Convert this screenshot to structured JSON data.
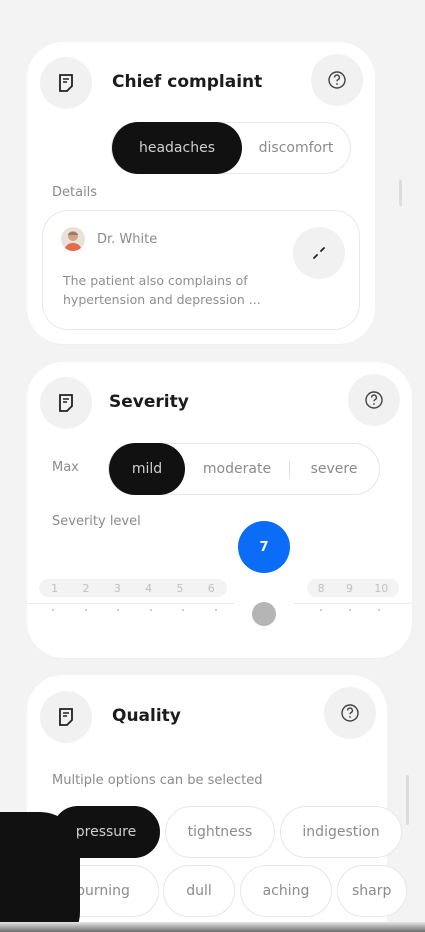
{
  "chief_complaint": {
    "title": "Chief complaint",
    "options": [
      "headaches",
      "discomfort"
    ],
    "selected": "headaches",
    "details_label": "Details",
    "doctor": "Dr. White",
    "details_text": "The patient also complains of hypertension and depression ..."
  },
  "severity": {
    "title": "Severity",
    "max_label": "Max",
    "options": [
      "mild",
      "moderate",
      "severe"
    ],
    "selected": "mild",
    "level_label": "Severity level",
    "level_value": "7",
    "scale_left": [
      "1",
      "2",
      "3",
      "4",
      "5",
      "6"
    ],
    "scale_right": [
      "8",
      "9",
      "10"
    ]
  },
  "quality": {
    "title": "Quality",
    "hint": "Multiple options can be selected",
    "options_row1": [
      "pressure",
      "tightness",
      "indigestion"
    ],
    "options_row2": [
      "burning",
      "dull",
      "aching",
      "sharp"
    ],
    "selected": [
      "pressure"
    ]
  },
  "colors": {
    "accent": "#0a6cf7",
    "active": "#111111"
  },
  "icons": [
    "note-icon",
    "help-icon",
    "expand-icon",
    "doctor-avatar"
  ]
}
